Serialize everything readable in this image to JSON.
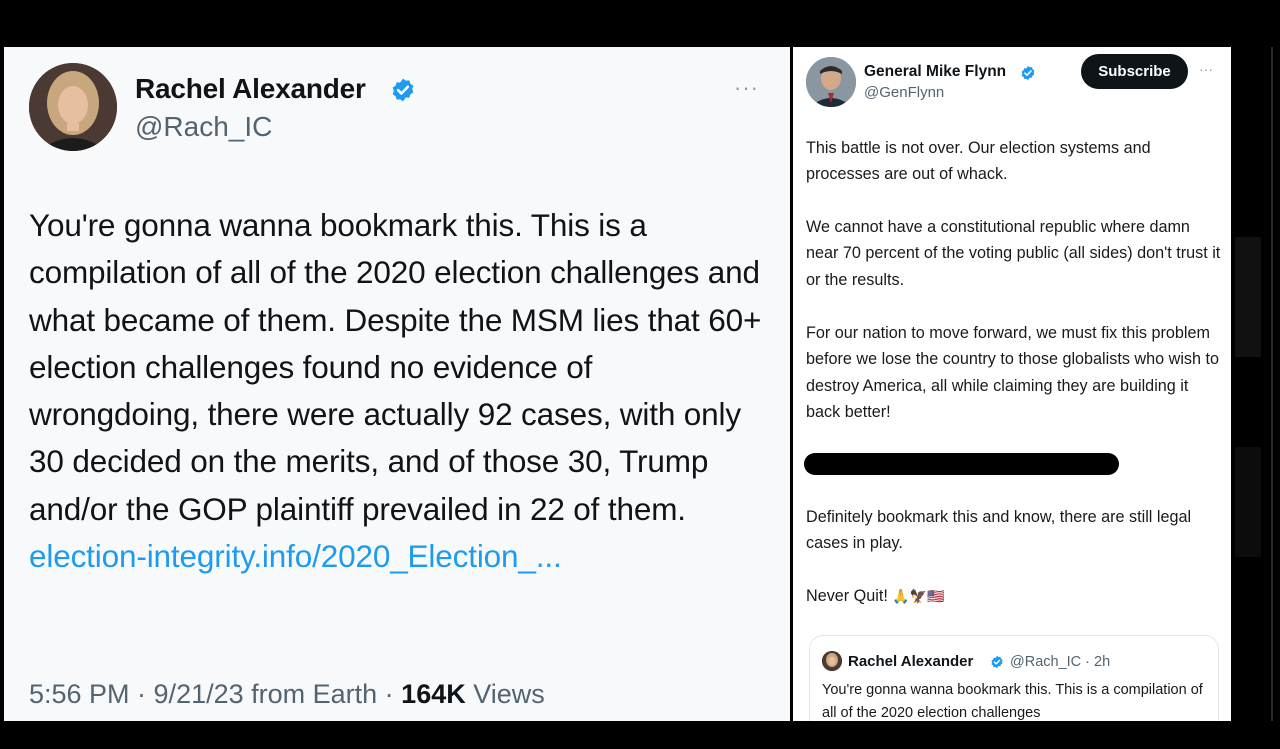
{
  "left_tweet": {
    "author_name": "Rachel Alexander",
    "handle": "@Rach_IC",
    "more_label": "···",
    "text": "You're gonna wanna bookmark this. This is a compilation of all of the 2020 election challenges and what became of them. Despite the MSM lies that 60+ election challenges found no evidence of wrongdoing, there were actually 92 cases, with only 30 decided on the merits, and of those 30, Trump and/or the GOP plaintiff prevailed in 22 of them.",
    "link_text": "election-integrity.info/2020_Election_...",
    "meta_prefix": "5:56 PM · 9/21/23 from Earth · ",
    "views_count": "164K",
    "views_label": " Views"
  },
  "right_tweet": {
    "author_name": "General Mike Flynn",
    "handle": "@GenFlynn",
    "subscribe_label": "Subscribe",
    "more_label": "···",
    "paragraphs": [
      "This battle is not over. Our election systems and processes are out of whack.",
      "We cannot have a constitutional republic where damn near 70 percent of the voting public (all sides) don't trust it or the results.",
      "For our nation to move forward, we must fix this problem before we lose the country to those globalists who wish to destroy America, all while claiming they are building it back better!",
      "Definitely bookmark this and know, there are still legal cases in play.",
      "Never Quit!"
    ],
    "emoji_text": "🙏🦅🇺🇸",
    "quoted": {
      "author_name": "Rachel Alexander",
      "meta": "@Rach_IC · 2h",
      "text": "You're gonna wanna bookmark this. This is a compilation of all of the 2020 election challenges"
    }
  },
  "colors": {
    "verified_blue": "#1d9bf0",
    "link_blue": "#1d9bf0",
    "secondary_text": "#536471"
  },
  "icons": [
    "verified-badge-icon",
    "more-options-icon"
  ]
}
